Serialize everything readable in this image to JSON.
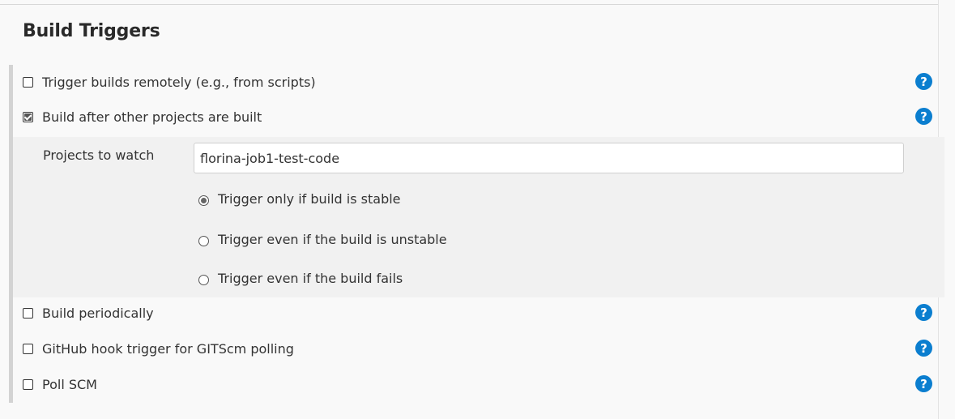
{
  "section": {
    "title": "Build Triggers"
  },
  "triggers": [
    {
      "label": "Trigger builds remotely (e.g., from scripts)",
      "checked": false
    },
    {
      "label": "Build after other projects are built",
      "checked": true
    },
    {
      "label": "Build periodically",
      "checked": false
    },
    {
      "label": "GitHub hook trigger for GITScm polling",
      "checked": false
    },
    {
      "label": "Poll SCM",
      "checked": false
    }
  ],
  "build_after": {
    "projects_label": "Projects to watch",
    "projects_value": "florina-job1-test-code",
    "options": [
      {
        "label": "Trigger only if build is stable",
        "selected": true
      },
      {
        "label": "Trigger even if the build is unstable",
        "selected": false
      },
      {
        "label": "Trigger even if the build fails",
        "selected": false
      }
    ]
  },
  "help": {
    "glyph": "?"
  },
  "colors": {
    "help_icon": "#0b7ecf",
    "background": "#f9f9f9",
    "sub_panel": "#f1f1f1"
  }
}
